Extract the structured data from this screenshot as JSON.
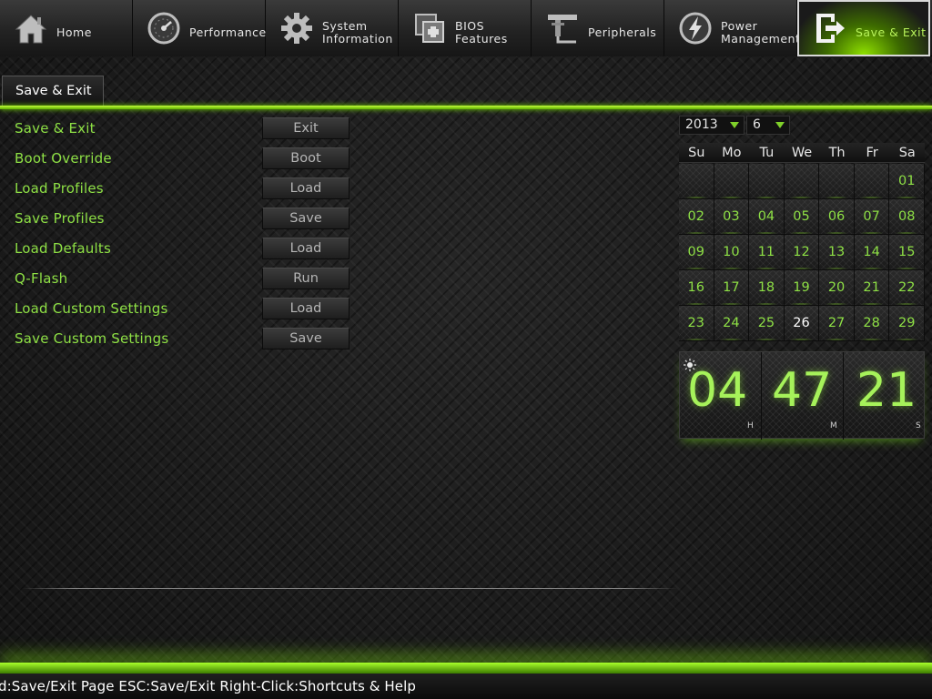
{
  "nav": {
    "items": [
      {
        "label": "Home",
        "icon": "home-icon",
        "active": false
      },
      {
        "label": "Performance",
        "icon": "gauge-icon",
        "active": false
      },
      {
        "label": "System\nInformation",
        "icon": "gear-icon",
        "active": false
      },
      {
        "label": "BIOS\nFeatures",
        "icon": "bios-chip-icon",
        "active": false
      },
      {
        "label": "Peripherals",
        "icon": "peripherals-icon",
        "active": false
      },
      {
        "label": "Power\nManagement",
        "icon": "power-icon",
        "active": false
      },
      {
        "label": "Save & Exit",
        "icon": "exit-door-icon",
        "active": true
      }
    ]
  },
  "page": {
    "tab_label": "Save & Exit"
  },
  "settings": [
    {
      "label": "Save & Exit",
      "button": "Exit"
    },
    {
      "label": "Boot Override",
      "button": "Boot"
    },
    {
      "label": "Load Profiles",
      "button": "Load"
    },
    {
      "label": "Save Profiles",
      "button": "Save"
    },
    {
      "label": "Load Defaults",
      "button": "Load"
    },
    {
      "label": "Q-Flash",
      "button": "Run"
    },
    {
      "label": "Load Custom Settings",
      "button": "Load"
    },
    {
      "label": "Save Custom Settings",
      "button": "Save"
    }
  ],
  "calendar": {
    "year": "2013",
    "month": "6",
    "weekdays": [
      "Su",
      "Mo",
      "Tu",
      "We",
      "Th",
      "Fr",
      "Sa"
    ],
    "days": [
      "",
      "",
      "",
      "",
      "",
      "",
      "01",
      "02",
      "03",
      "04",
      "05",
      "06",
      "07",
      "08",
      "09",
      "10",
      "11",
      "12",
      "13",
      "14",
      "15",
      "16",
      "17",
      "18",
      "19",
      "20",
      "21",
      "22",
      "23",
      "24",
      "25",
      "26",
      "27",
      "28",
      "29"
    ],
    "today": "26"
  },
  "clock": {
    "hours": "04",
    "minutes": "47",
    "seconds": "21",
    "hour_unit": "H",
    "minute_unit": "M",
    "second_unit": "S"
  },
  "footer": {
    "hint": "d:Save/Exit Page ESC:Save/Exit Right-Click:Shortcuts & Help"
  },
  "colors": {
    "accent_green": "#8ee045",
    "bright_green": "#a6f25a",
    "text_white": "#ffffff",
    "button_text": "#b5b5b5"
  }
}
